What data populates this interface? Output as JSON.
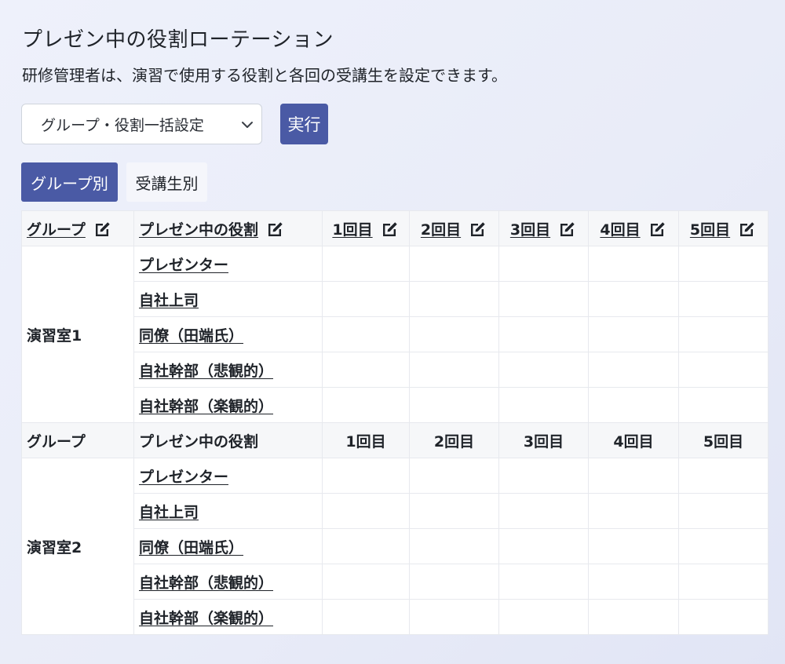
{
  "page": {
    "title": "プレゼン中の役割ローテーション",
    "description": "研修管理者は、演習で使用する役割と各回の受講生を設定できます。"
  },
  "toolbar": {
    "select_value": "グループ・役割一括設定",
    "run_label": "実行"
  },
  "tabs": {
    "by_group": "グループ別",
    "by_student": "受講生別"
  },
  "colors": {
    "accent": "#4a5aa5",
    "background": "#eef1fb"
  },
  "table": {
    "headers": {
      "group": "グループ",
      "role": "プレゼン中の役割",
      "r1": "1回目",
      "r2": "2回目",
      "r3": "3回目",
      "r4": "4回目",
      "r5": "5回目"
    },
    "groups": [
      {
        "name": "演習室1",
        "roles": [
          "プレゼンター",
          "自社上司",
          "同僚（田端氏）",
          "自社幹部（悲観的）",
          "自社幹部（楽観的）"
        ]
      },
      {
        "name": "演習室2",
        "roles": [
          "プレゼンター",
          "自社上司",
          "同僚（田端氏）",
          "自社幹部（悲観的）",
          "自社幹部（楽観的）"
        ]
      }
    ]
  }
}
